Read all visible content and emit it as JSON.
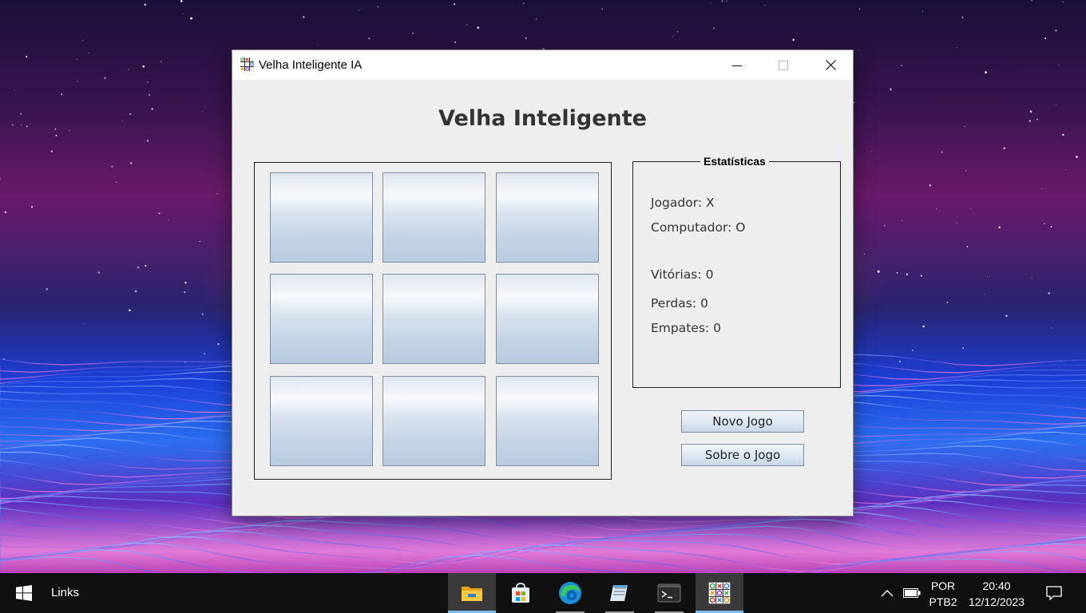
{
  "window": {
    "title": "Velha Inteligente IA",
    "heading": "Velha Inteligente"
  },
  "board": {
    "cells": [
      "",
      "",
      "",
      "",
      "",
      "",
      "",
      "",
      ""
    ]
  },
  "stats": {
    "legend": "Estatísticas",
    "player_label": "Jogador:",
    "player_value": "X",
    "computer_label": "Computador:",
    "computer_value": "O",
    "wins_label": "Vitórias:",
    "wins_value": "0",
    "losses_label": "Perdas:",
    "losses_value": "0",
    "draws_label": "Empates:",
    "draws_value": "0"
  },
  "buttons": {
    "new_game": "Novo Jogo",
    "about": "Sobre o Jogo"
  },
  "taskbar": {
    "links_label": "Links",
    "pinned_apps": [
      "file-explorer",
      "microsoft-store",
      "edge",
      "notepad",
      "terminal",
      "velha-inteligente"
    ],
    "language_primary": "POR",
    "language_secondary": "PTB2",
    "time": "20:40",
    "date": "12/12/2023"
  },
  "colors": {
    "window_bg": "#eeeeee",
    "cell_border": "#7a8ea8",
    "taskbar_bg": "#101010",
    "active_underline": "#76b9ed"
  }
}
